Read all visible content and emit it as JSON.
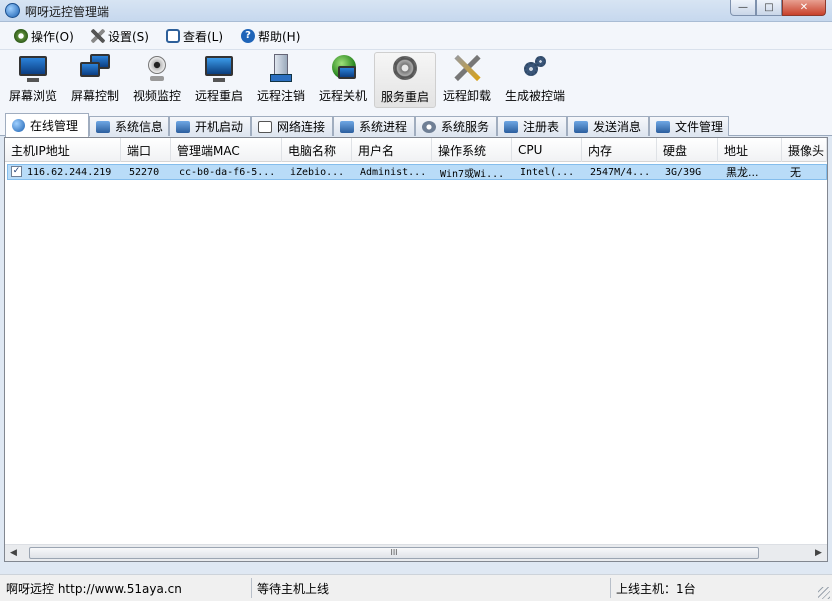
{
  "window": {
    "title": "啊呀远控管理端",
    "buttons": [
      "—",
      "□",
      "✕"
    ]
  },
  "menu": [
    {
      "label": "操作(O)",
      "icon": "gear-icon"
    },
    {
      "label": "设置(S)",
      "icon": "tools-icon"
    },
    {
      "label": "查看(L)",
      "icon": "view-icon"
    },
    {
      "label": "帮助(H)",
      "icon": "help-icon"
    }
  ],
  "toolbar": [
    {
      "label": "屏幕浏览",
      "icon": "monitor-icon"
    },
    {
      "label": "屏幕控制",
      "icon": "monitors-icon"
    },
    {
      "label": "视频监控",
      "icon": "webcam-icon"
    },
    {
      "label": "远程重启",
      "icon": "restart-icon"
    },
    {
      "label": "远程注销",
      "icon": "logoff-icon"
    },
    {
      "label": "远程关机",
      "icon": "shutdown-icon"
    },
    {
      "label": "服务重启",
      "icon": "service-gear-icon"
    },
    {
      "label": "远程卸载",
      "icon": "uninstall-tools-icon"
    },
    {
      "label": "生成被控端",
      "icon": "build-gears-icon"
    }
  ],
  "tabs": [
    {
      "label": "在线管理"
    },
    {
      "label": "系统信息"
    },
    {
      "label": "开机启动"
    },
    {
      "label": "网络连接"
    },
    {
      "label": "系统进程"
    },
    {
      "label": "系统服务"
    },
    {
      "label": "注册表"
    },
    {
      "label": "发送消息"
    },
    {
      "label": "文件管理"
    }
  ],
  "table": {
    "columns": [
      "主机IP地址",
      "端口",
      "管理端MAC",
      "电脑名称",
      "用户名",
      "操作系统",
      "CPU",
      "内存",
      "硬盘",
      "地址",
      "摄像头"
    ],
    "rows": [
      {
        "checked": "✓",
        "cells": [
          "116.62.244.219",
          "52270",
          "cc-b0-da-f6-5...",
          "iZebio...",
          "Administ...",
          "Win7或Wi...",
          "Intel(...",
          "2547M/4...",
          "3G/39G",
          "黑龙...",
          "无"
        ]
      }
    ]
  },
  "scrollbar": {
    "left": "◀",
    "right": "▶",
    "grip": "III"
  },
  "status": {
    "left": "啊呀远控 http://www.51aya.cn",
    "middle": "等待主机上线",
    "right": "上线主机：1台"
  },
  "colors": {
    "selection": "#b9dcf8",
    "accent": "#1a5fb0"
  }
}
